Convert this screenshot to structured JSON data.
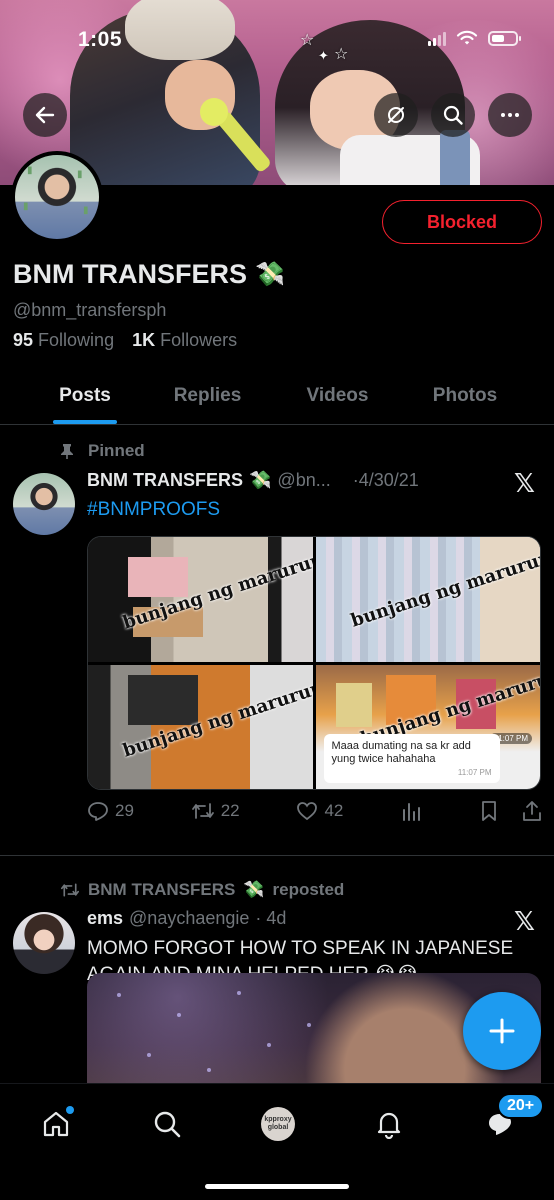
{
  "status_bar": {
    "time": "1:05"
  },
  "profile": {
    "name": "BNM TRANSFERS",
    "name_emoji": "💸",
    "handle": "@bnm_transfersph",
    "following_count": "95",
    "following_label": "Following",
    "followers_count": "1K",
    "followers_label": "Followers",
    "blocked_label": "Blocked"
  },
  "tabs": [
    {
      "label": "Posts",
      "active": true
    },
    {
      "label": "Replies",
      "active": false
    },
    {
      "label": "Videos",
      "active": false
    },
    {
      "label": "Photos",
      "active": false
    }
  ],
  "pinned_post": {
    "pinned_label": "Pinned",
    "author": "BNM TRANSFERS",
    "author_emoji": "💸",
    "handle": "@bn...",
    "date": "·4/30/21",
    "text": "#BNMPROOFS",
    "watermark": "bunjang ng marurupok",
    "chat_bubble_text": "Maaa dumating na sa kr add yung twice hahahaha",
    "chat_bubble_time": "11:07 PM",
    "tile_time": "11:07 PM",
    "stats": {
      "replies": "29",
      "reposts": "22",
      "likes": "42"
    }
  },
  "repost": {
    "reposted_by": "BNM TRANSFERS",
    "reposted_emoji": "💸",
    "reposted_label": "reposted",
    "author": "ems",
    "handle": "@naychaengie",
    "date": "· 4d",
    "text": "MOMO FORGOT HOW TO SPEAK IN JAPANESE AGAIN AND MINA HELPED HER 😭😭"
  },
  "bottom_nav": {
    "community_avatar_text": "kpproxy global",
    "messages_badge": "20+"
  },
  "colors": {
    "accent": "#1d9bf0",
    "blocked": "#f4212e",
    "muted": "#71767b",
    "text": "#e7e9ea"
  }
}
